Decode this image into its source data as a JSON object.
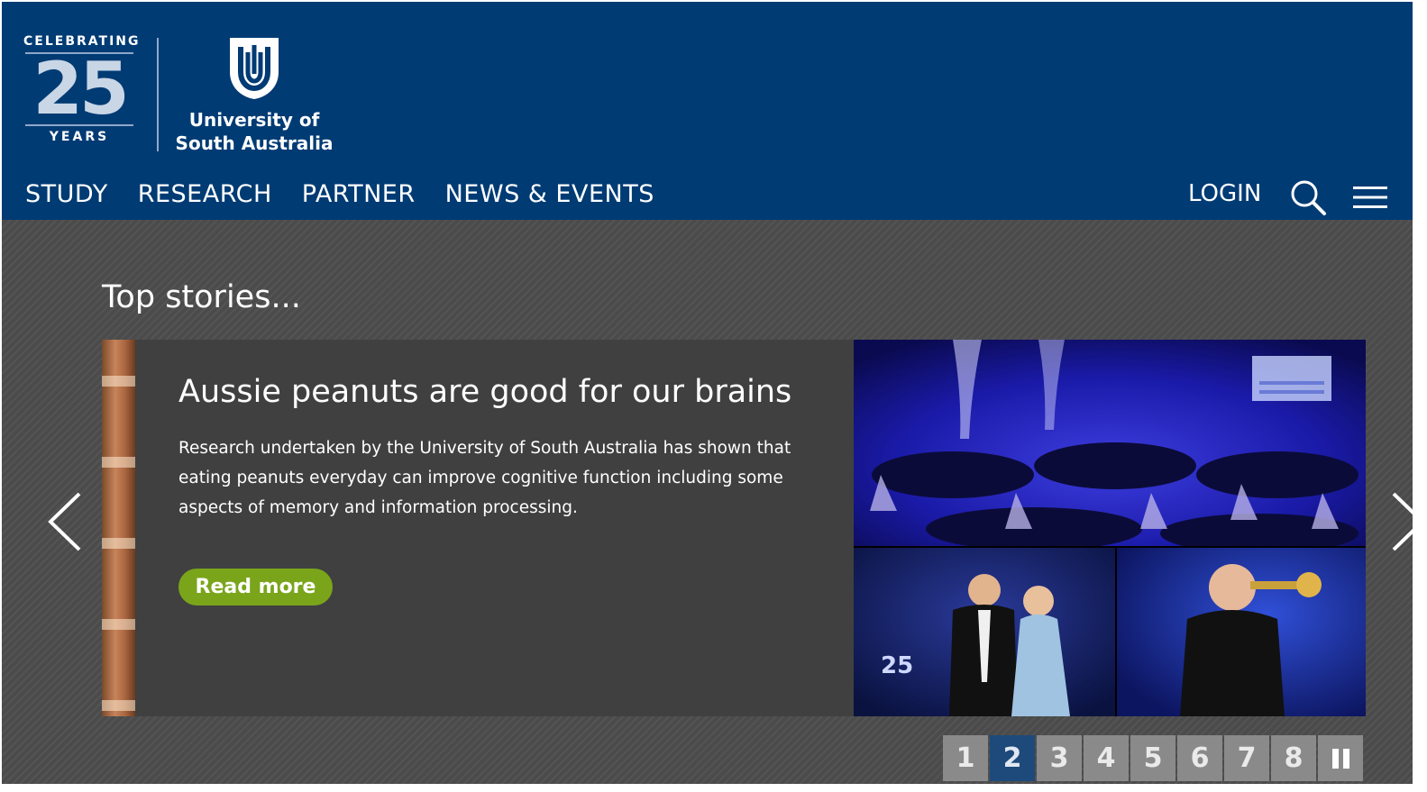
{
  "header": {
    "anniversary": {
      "top": "CELEBRATING",
      "number": "25",
      "bottom": "YEARS"
    },
    "university": {
      "line1": "University of",
      "line2": "South Australia"
    },
    "nav": [
      "STUDY",
      "RESEARCH",
      "PARTNER",
      "NEWS & EVENTS"
    ],
    "login": "LOGIN",
    "icons": {
      "search": "search-icon",
      "menu": "hamburger-menu-icon"
    }
  },
  "main": {
    "section_title": "Top stories...",
    "story": {
      "title": "Aussie peanuts are good for our brains",
      "text": "Research undertaken by the University of South Australia has shown that eating peanuts everyday can improve cognitive function including some aspects of memory and information processing.",
      "button": "Read more"
    },
    "pager": {
      "pages": [
        "1",
        "2",
        "3",
        "4",
        "5",
        "6",
        "7",
        "8"
      ],
      "active": "2"
    }
  },
  "colors": {
    "header_bg": "#003b74",
    "button_green": "#7aa51b",
    "pager_active": "#1d4a7a",
    "pager_bg": "#8a8a8a"
  }
}
